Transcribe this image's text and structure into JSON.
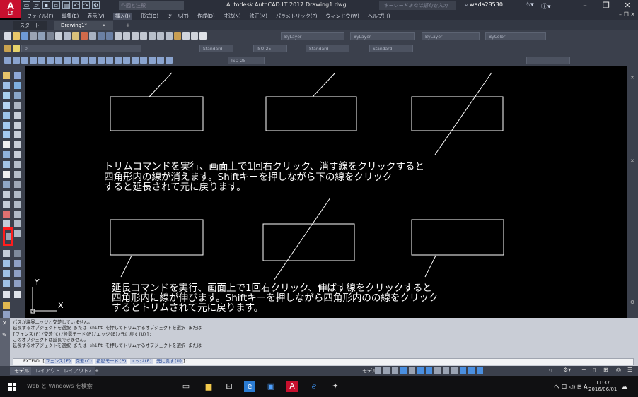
{
  "title_bar": {
    "app_logo": "A",
    "app_logo_sub": "LT",
    "workspace": "作図と注釈",
    "window_title": "Autodesk AutoCAD LT 2017   Drawing1.dwg",
    "search_placeholder": "キーワードまたは語句を入力",
    "user_name": "wada28530",
    "help_icon": "help-icon"
  },
  "menu": {
    "items": [
      "ファイル(F)",
      "編集(E)",
      "表示(V)",
      "挿入(I)",
      "形式(O)",
      "ツール(T)",
      "作成(D)",
      "寸法(N)",
      "修正(M)",
      "パラメトリック(P)",
      "ウィンドウ(W)",
      "ヘルプ(H)"
    ],
    "active_index": 3
  },
  "file_tabs": {
    "start": "スタート",
    "drawing": "Drawing1*",
    "close": "×",
    "add": "+"
  },
  "toolbar": {
    "layer": "ByLayer",
    "linetype": "ByLayer",
    "lineweight": "ByLayer",
    "color": "ByColor",
    "layer_name": "0",
    "text_style": "Standard",
    "dim_style": "ISO-25",
    "table_style": "Standard",
    "multileader_style": "Standard",
    "dim_style2": "ISO-25"
  },
  "canvas": {
    "text_block1": {
      "line1": "トリムコマンドを実行、画面上で1回右クリック、消す線をクリックすると",
      "line2": "四角形内の線が消えます。Shiftキーを押しながら下の線をクリック",
      "line3": "すると延長されて元に戻ります。"
    },
    "text_block2": {
      "line1": "延長コマンドを実行、画面上で1回右クリック、伸ばす線をクリックすると",
      "line2": "四角形内に線が伸びます。Shiftキーを押しながら四角形内のの線をクリック",
      "line3": "するとトリムされて元に戻ります。"
    },
    "ucs_y": "Y",
    "ucs_x": "X"
  },
  "command": {
    "log": [
      "パスが境界エッジと交差していません。",
      "延長するオブジェクトを選択 または shift を押してトリムするオブジェクトを選択 または",
      "[フェンス(F)/交差(C)/投影モード(P)/エッジ(E)/元に戻す(U)]:",
      "このオブジェクトは延長できません。",
      "延長するオブジェクトを選択 または shift を押してトリムするオブジェクトを選択 または"
    ],
    "input_prefix": "EXTEND [",
    "opt_fence": "フェンス(F)",
    "opt_cross": "交差(C)",
    "opt_proj": "投影モード(P)",
    "opt_edge": "エッジ(E)",
    "opt_undo": "元に戻す(U)",
    "input_suffix": "]:"
  },
  "layout_tabs": {
    "model": "モデル",
    "layout1": "レイアウト1",
    "layout2": "レイアウト2",
    "add": "+"
  },
  "status": {
    "model": "モデル",
    "scale": "1:1"
  },
  "taskbar": {
    "search": "Web と Windows を検索",
    "tray": "へ 口 ◁) ⊟ A",
    "time": "11:37",
    "date": "2016/06/01"
  },
  "colors": {
    "highlight_box": "#ff1c1c",
    "canvas_bg": "#000000",
    "drawing_lines": "#ffffff"
  }
}
